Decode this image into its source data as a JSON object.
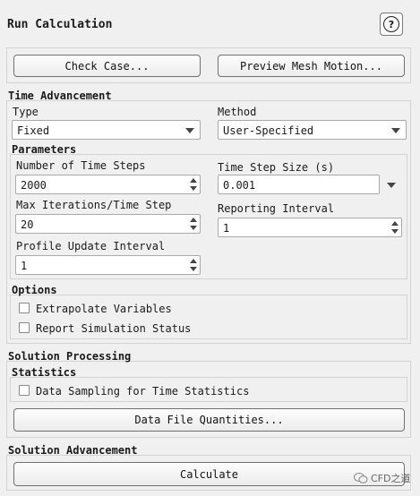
{
  "header": {
    "title": "Run Calculation",
    "help_icon": "?"
  },
  "buttons": {
    "check_case": "Check Case...",
    "preview_mesh_motion": "Preview Mesh Motion...",
    "data_file_quantities": "Data File Quantities...",
    "calculate": "Calculate"
  },
  "time_advancement": {
    "heading": "Time Advancement",
    "type_label": "Type",
    "type_value": "Fixed",
    "method_label": "Method",
    "method_value": "User-Specified"
  },
  "parameters": {
    "heading": "Parameters",
    "num_time_steps_label": "Number of Time Steps",
    "num_time_steps_value": "2000",
    "time_step_size_label": "Time Step Size (s)",
    "time_step_size_value": "0.001",
    "max_iterations_label": "Max Iterations/Time Step",
    "max_iterations_value": "20",
    "reporting_interval_label": "Reporting Interval",
    "reporting_interval_value": "1",
    "profile_update_label": "Profile Update Interval",
    "profile_update_value": "1"
  },
  "options": {
    "heading": "Options",
    "extrapolate_variables": {
      "label": "Extrapolate Variables",
      "checked": false
    },
    "report_simulation_status": {
      "label": "Report Simulation Status",
      "checked": false
    }
  },
  "solution_processing": {
    "heading": "Solution Processing",
    "statistics_heading": "Statistics",
    "data_sampling": {
      "label": "Data Sampling for Time Statistics",
      "checked": false
    }
  },
  "solution_advancement": {
    "heading": "Solution Advancement"
  },
  "watermark": {
    "text": "CFD之道"
  }
}
